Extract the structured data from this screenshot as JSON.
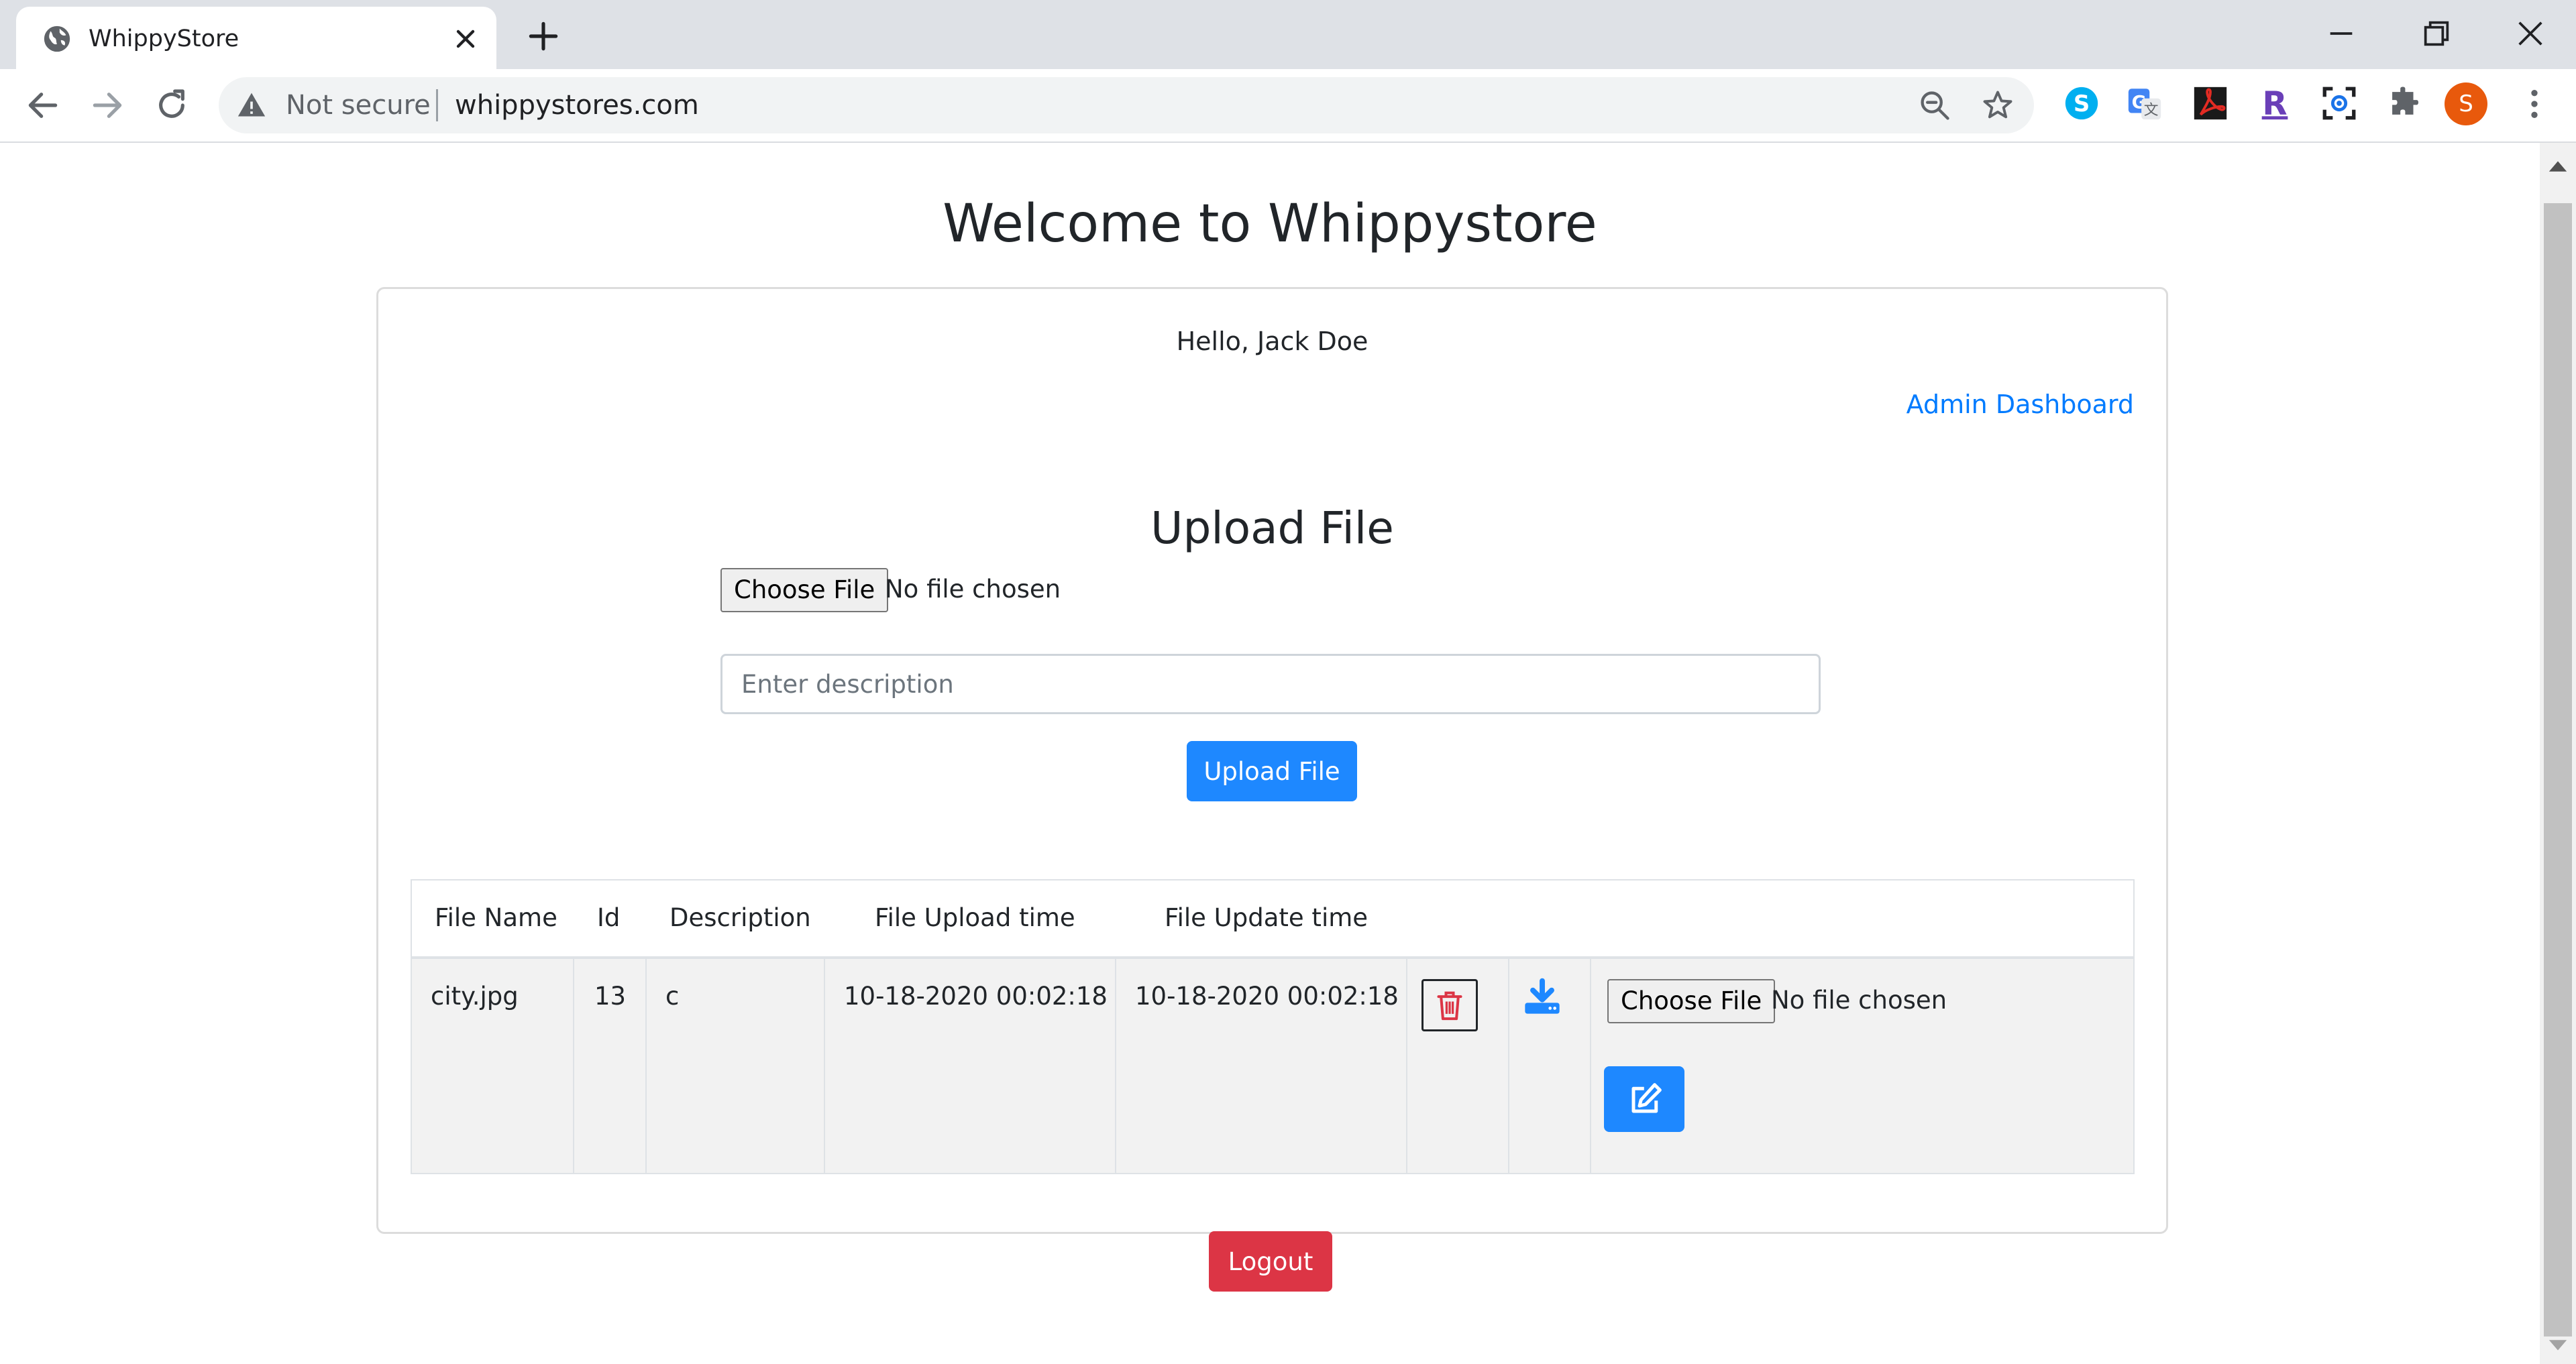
{
  "browser": {
    "tab_title": "WhippyStore",
    "security_label": "Not secure",
    "url": "whippystores.com",
    "profile_initial": "S",
    "icons": [
      "globe-icon",
      "close-icon",
      "plus-icon",
      "minimize-icon",
      "restore-icon",
      "window-close-icon",
      "back-icon",
      "forward-icon",
      "reload-icon",
      "warning-icon",
      "zoom-icon",
      "star-icon",
      "skype-icon",
      "translate-icon",
      "acrobat-icon",
      "r-extension-icon",
      "screenshot-icon",
      "puzzle-icon",
      "kebab-menu-icon"
    ]
  },
  "page": {
    "title": "Welcome to Whippystore",
    "greeting": "Hello, Jack Doe",
    "admin_link": "Admin Dashboard",
    "upload": {
      "heading": "Upload File",
      "choose_label": "Choose File",
      "file_status": "No file chosen",
      "description_placeholder": "Enter description",
      "submit_label": "Upload File"
    },
    "table": {
      "headers": [
        "File Name",
        "Id",
        "Description",
        "File Upload time",
        "File Update time"
      ],
      "rows": [
        {
          "file_name": "city.jpg",
          "id": "13",
          "description": "c",
          "upload_time": "10-18-2020 00:02:18",
          "update_time": "10-18-2020 00:02:18",
          "choose_label": "Choose File",
          "file_status": "No file chosen"
        }
      ]
    },
    "logout_label": "Logout"
  },
  "colors": {
    "primary": "#1e88ff",
    "danger": "#dc3545",
    "link": "#007bff"
  }
}
